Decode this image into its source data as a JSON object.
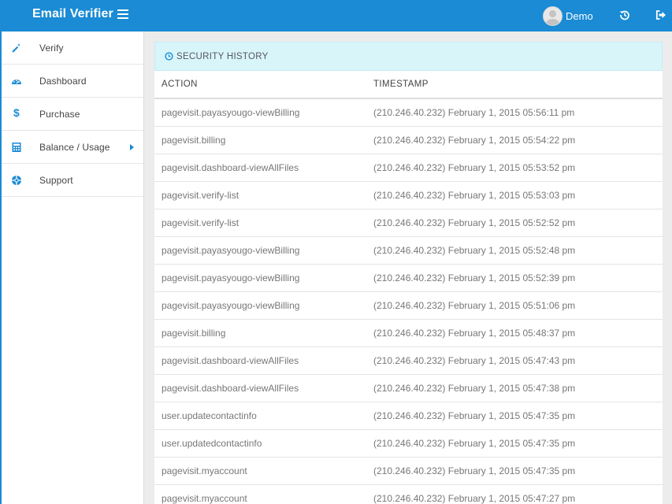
{
  "app": {
    "title": "Email Verifier",
    "accent_color": "#1a8bd4"
  },
  "header": {
    "menu_icon": "hamburger-icon",
    "user_name": "Demo",
    "icons": [
      "history-icon",
      "logout-icon"
    ]
  },
  "sidebar": {
    "items": [
      {
        "label": "Verify",
        "icon": "magic-wand-icon"
      },
      {
        "label": "Dashboard",
        "icon": "dashboard-icon"
      },
      {
        "label": "Purchase",
        "icon": "dollar-icon"
      },
      {
        "label": "Balance / Usage",
        "icon": "calculator-icon",
        "has_submenu": true
      },
      {
        "label": "Support",
        "icon": "life-ring-icon"
      }
    ]
  },
  "panel": {
    "title": "SECURITY HISTORY",
    "title_icon": "clock-icon",
    "columns": [
      "ACTION",
      "TIMESTAMP"
    ],
    "rows": [
      {
        "action": "pagevisit.payasyougo-viewBilling",
        "timestamp": "(210.246.40.232) February 1, 2015 05:56:11 pm"
      },
      {
        "action": "pagevisit.billing",
        "timestamp": "(210.246.40.232) February 1, 2015 05:54:22 pm"
      },
      {
        "action": "pagevisit.dashboard-viewAllFiles",
        "timestamp": "(210.246.40.232) February 1, 2015 05:53:52 pm"
      },
      {
        "action": "pagevisit.verify-list",
        "timestamp": "(210.246.40.232) February 1, 2015 05:53:03 pm"
      },
      {
        "action": "pagevisit.verify-list",
        "timestamp": "(210.246.40.232) February 1, 2015 05:52:52 pm"
      },
      {
        "action": "pagevisit.payasyougo-viewBilling",
        "timestamp": "(210.246.40.232) February 1, 2015 05:52:48 pm"
      },
      {
        "action": "pagevisit.payasyougo-viewBilling",
        "timestamp": "(210.246.40.232) February 1, 2015 05:52:39 pm"
      },
      {
        "action": "pagevisit.payasyougo-viewBilling",
        "timestamp": "(210.246.40.232) February 1, 2015 05:51:06 pm"
      },
      {
        "action": "pagevisit.billing",
        "timestamp": "(210.246.40.232) February 1, 2015 05:48:37 pm"
      },
      {
        "action": "pagevisit.dashboard-viewAllFiles",
        "timestamp": "(210.246.40.232) February 1, 2015 05:47:43 pm"
      },
      {
        "action": "pagevisit.dashboard-viewAllFiles",
        "timestamp": "(210.246.40.232) February 1, 2015 05:47:38 pm"
      },
      {
        "action": "user.updatecontactinfo",
        "timestamp": "(210.246.40.232) February 1, 2015 05:47:35 pm"
      },
      {
        "action": "user.updatedcontactinfo",
        "timestamp": "(210.246.40.232) February 1, 2015 05:47:35 pm"
      },
      {
        "action": "pagevisit.myaccount",
        "timestamp": "(210.246.40.232) February 1, 2015 05:47:35 pm"
      },
      {
        "action": "pagevisit.myaccount",
        "timestamp": "(210.246.40.232) February 1, 2015 05:47:27 pm"
      }
    ]
  }
}
